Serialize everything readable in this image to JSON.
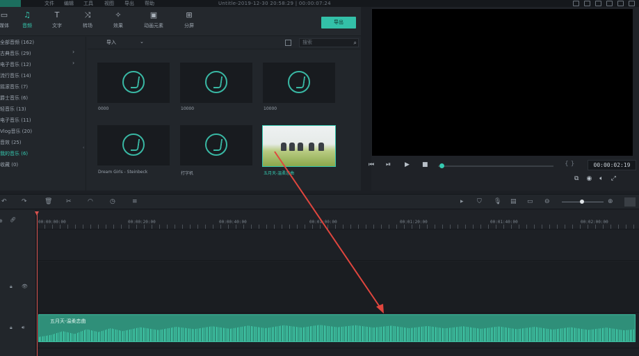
{
  "menubar": {
    "items": [
      "文件",
      "编辑",
      "工具",
      "视图",
      "导出",
      "帮助"
    ],
    "window_title": "Untitle-2019-12-30 20:58:29 | 00:00:07:24"
  },
  "top_tabs": [
    {
      "label": "媒体",
      "icon": "media-icon"
    },
    {
      "label": "音频",
      "icon": "music-note-icon",
      "active": true
    },
    {
      "label": "文字",
      "icon": "text-icon"
    },
    {
      "label": "转场",
      "icon": "transition-icon"
    },
    {
      "label": "效果",
      "icon": "effects-icon"
    },
    {
      "label": "动画元素",
      "icon": "elements-icon"
    },
    {
      "label": "分屏",
      "icon": "split-screen-icon"
    }
  ],
  "export_label": "导出",
  "sidebar_items": [
    {
      "label": "全部音频 (162)"
    },
    {
      "label": "古典音乐 (29)",
      "has_children": true
    },
    {
      "label": "电子音乐 (12)",
      "has_children": true
    },
    {
      "label": "流行音乐 (14)"
    },
    {
      "label": "摇滚音乐 (7)"
    },
    {
      "label": "爵士音乐 (6)"
    },
    {
      "label": "轻音乐 (13)"
    },
    {
      "label": "电子音乐 (11)"
    },
    {
      "label": "Vlog音乐 (20)"
    },
    {
      "label": "音效 (25)"
    },
    {
      "label": "我的音乐 (6)",
      "selected": true
    },
    {
      "label": "收藏 (0)"
    }
  ],
  "media_toolbar": {
    "import_label": "导入",
    "search_placeholder": "搜索"
  },
  "media_items": [
    {
      "label": "0000",
      "type": "audio"
    },
    {
      "label": "10000",
      "type": "audio"
    },
    {
      "label": "10000",
      "type": "audio"
    },
    {
      "label": "Dream Girls - Steinbeck",
      "type": "audio"
    },
    {
      "label": "打字机",
      "type": "audio"
    },
    {
      "label": "五月天-温柔恋曲",
      "type": "video",
      "selected": true
    }
  ],
  "preview": {
    "timecode": "00:00:02:19",
    "progress": 0.03
  },
  "timeline": {
    "ruler_ticks": [
      "00:00:00:00",
      "00:00:20:00",
      "00:00:40:00",
      "00:01:00:00",
      "00:01:20:00",
      "00:01:40:00",
      "00:02:00:00"
    ],
    "audio_clip_label": "五月天-温柔恋曲"
  },
  "colors": {
    "accent": "#35c9b0",
    "audio_clip": "#2f8f79",
    "annotation_arrow": "#e0463e"
  }
}
